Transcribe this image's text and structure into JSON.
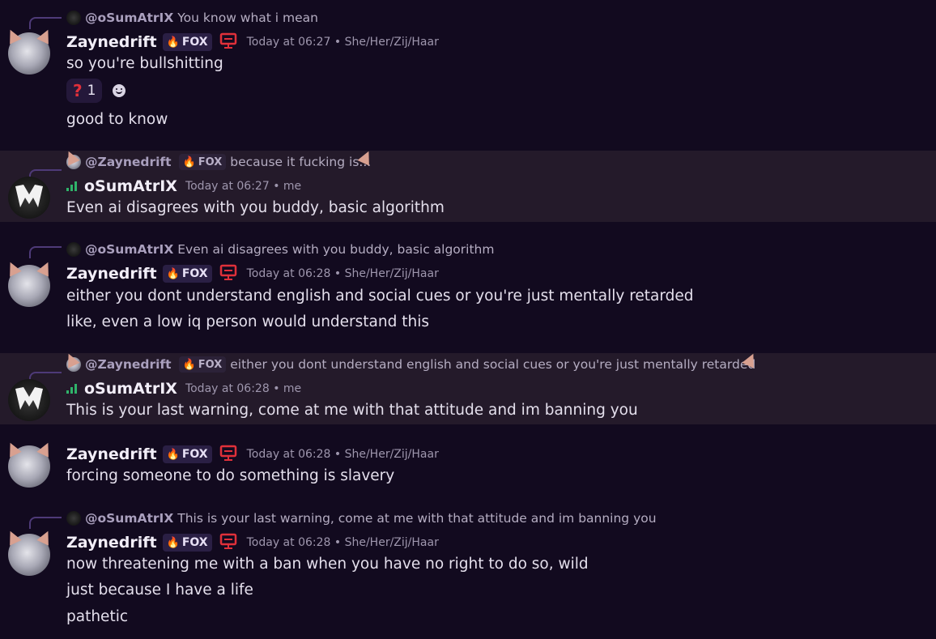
{
  "users": {
    "zayne": {
      "name": "Zaynedrift",
      "tag": "FOX",
      "pronouns": "She/Her/Zij/Haar"
    },
    "osum": {
      "name": "oSumAtrIX",
      "note": "me"
    }
  },
  "separator": "•",
  "messages": [
    {
      "reply_to": "@oSumAtrIX",
      "reply_text": "You know what i mean",
      "author": "Zaynedrift",
      "tag": "FOX",
      "time": "Today at 06:27",
      "suffix": "She/Her/Zij/Haar",
      "lines": [
        "so you're bullshitting",
        "good to know"
      ],
      "reactions": [
        {
          "emoji": "question-mark",
          "glyph": "?",
          "count": "1"
        }
      ]
    },
    {
      "reply_to": "@Zaynedrift",
      "reply_tag": "FOX",
      "reply_text": "because it fucking is...",
      "author": "oSumAtrIX",
      "time": "Today at 06:27",
      "suffix": "me",
      "lines": [
        "Even ai disagrees with you buddy, basic algorithm"
      ],
      "highlight_color": "#241a2a"
    },
    {
      "reply_to": "@oSumAtrIX",
      "reply_text": "Even ai disagrees with you buddy, basic algorithm",
      "author": "Zaynedrift",
      "tag": "FOX",
      "time": "Today at 06:28",
      "suffix": "She/Her/Zij/Haar",
      "lines": [
        "either you dont understand english and social cues or you're just mentally retarded",
        "like, even a low iq person would understand this"
      ]
    },
    {
      "reply_to": "@Zaynedrift",
      "reply_tag": "FOX",
      "reply_text": "either you dont understand english and social cues or you're just mentally retarded",
      "author": "oSumAtrIX",
      "time": "Today at 06:28",
      "suffix": "me",
      "lines": [
        "This is your last warning, come at me with that attitude and im banning you"
      ]
    },
    {
      "author": "Zaynedrift",
      "tag": "FOX",
      "time": "Today at 06:28",
      "suffix": "She/Her/Zij/Haar",
      "lines": [
        "forcing someone to do something is slavery"
      ]
    },
    {
      "reply_to": "@oSumAtrIX",
      "reply_text": "This is your last warning, come at me with that attitude and im banning you",
      "author": "Zaynedrift",
      "tag": "FOX",
      "time": "Today at 06:28",
      "suffix": "She/Her/Zij/Haar",
      "lines": [
        "now threatening me with a ban when you have no right to do so, wild",
        "just because I have a life",
        "pathetic"
      ]
    }
  ],
  "colors": {
    "background": "#120a1f",
    "highlight": "#241a2a",
    "monitor_icon": "#e0303a",
    "signal_bars": "#2fb36a",
    "reaction_bg": "#24183a"
  },
  "icons": {
    "fox_tag": "fire-icon",
    "device": "monitor-icon",
    "connection": "signal-bars-icon",
    "add_reaction": "smile-icon"
  }
}
